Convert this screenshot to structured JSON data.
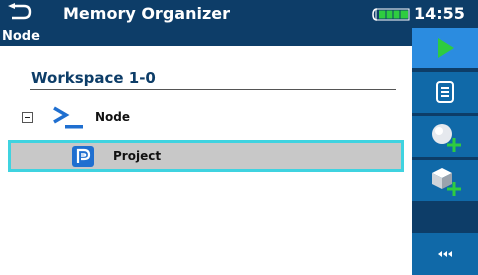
{
  "header": {
    "title": "Memory Organizer",
    "time": "14:55",
    "battery_level": 0.85
  },
  "subheader": {
    "label": "Node"
  },
  "tree": {
    "workspace_label": "Workspace 1-0",
    "node_label": "Node",
    "project_label": "Project"
  },
  "colors": {
    "header_bg": "#0d3d68",
    "sidebar_btn": "#1069a8",
    "selection_border": "#3fd3e0",
    "accent_green": "#2ecc40"
  },
  "sidebar_icons": [
    "play-icon",
    "list-icon",
    "add-sphere-icon",
    "add-cube-icon",
    "more-icon"
  ]
}
